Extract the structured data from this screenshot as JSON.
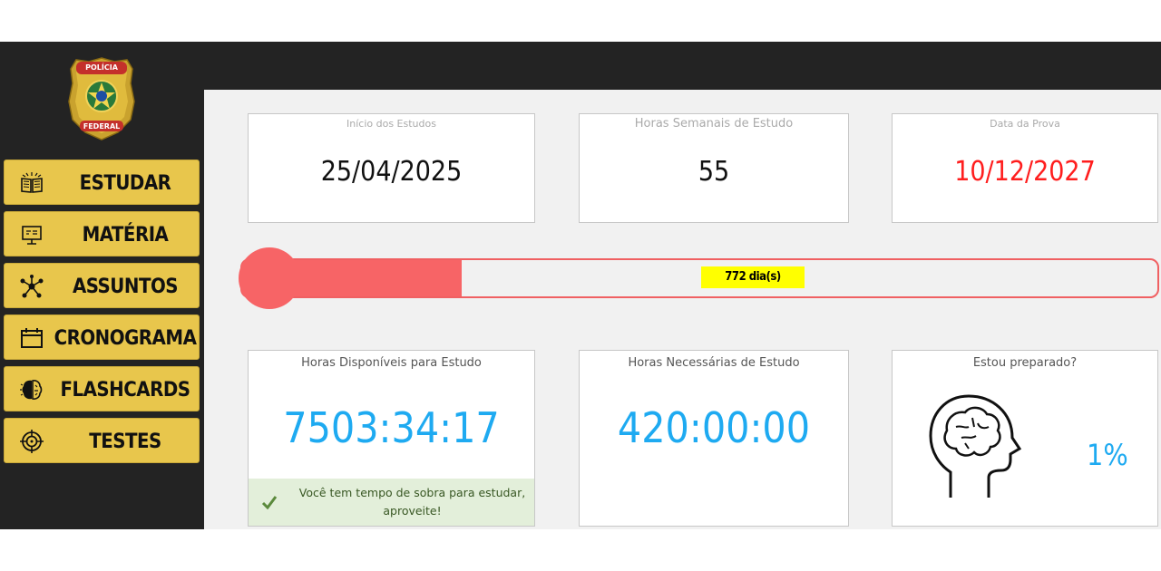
{
  "logo": {
    "top_text": "POLÍCIA",
    "bottom_text": "FEDERAL"
  },
  "sidebar": {
    "items": [
      {
        "label": "ESTUDAR",
        "icon": "open-book-icon"
      },
      {
        "label": "MATÉRIA",
        "icon": "presentation-board-icon"
      },
      {
        "label": "ASSUNTOS",
        "icon": "network-nodes-icon"
      },
      {
        "label": "CRONOGRAMA",
        "icon": "calendar-icon"
      },
      {
        "label": "FLASHCARDS",
        "icon": "brain-icon"
      },
      {
        "label": "TESTES",
        "icon": "target-crosshair-icon"
      }
    ]
  },
  "stats": {
    "inicio": {
      "title": "Início dos Estudos",
      "value": "25/04/2025"
    },
    "horas_semanais": {
      "title": "Horas Semanais de Estudo",
      "value": "55"
    },
    "data_prova": {
      "title": "Data da Prova",
      "value": "10/12/2027",
      "color": "#ff1e1e"
    }
  },
  "progress": {
    "days_label": "772 dia(s)",
    "fraction": 0.24
  },
  "hours": {
    "disponiveis": {
      "title": "Horas Disponíveis para Estudo",
      "value": "7503:34:17"
    },
    "necessarias": {
      "title": "Horas Necessárias de Estudo",
      "value": "420:00:00"
    },
    "preparado": {
      "title": "Estou preparado?",
      "value": "1%",
      "icon": "head-brain-icon"
    }
  },
  "tip": {
    "text": "Você tem tempo de sobra para estudar, aproveite!",
    "icon": "checkmark-icon"
  },
  "colors": {
    "accent_blue": "#1eaaf1",
    "button_gold": "#e8c64c",
    "progress_red": "#f76466",
    "dark_bg": "#232323"
  }
}
